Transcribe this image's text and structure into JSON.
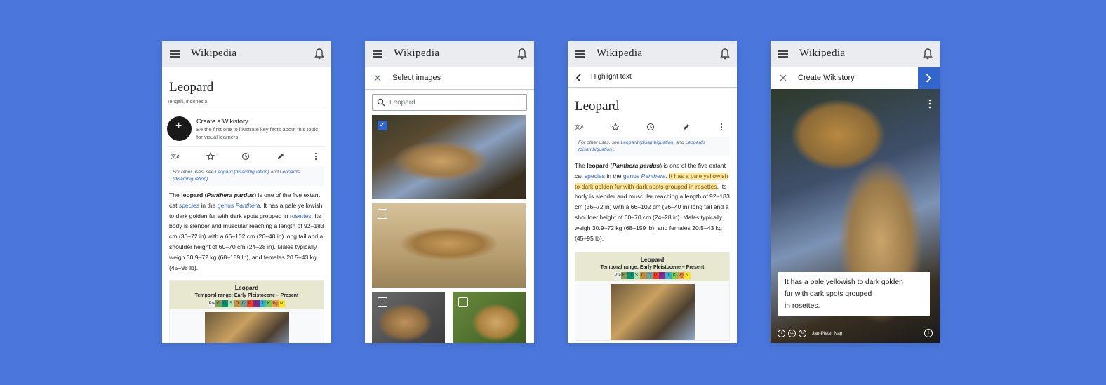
{
  "brand": {
    "wordmark": "Wikipedia",
    "background": "#4b77dc",
    "link_color": "#3366cc",
    "highlight_color": "#fce8a4"
  },
  "article": {
    "title": "Leopard",
    "subtitle": "Tengah, Indonesia",
    "hatnote_pre": "For other uses, see ",
    "hatnote_link1": "Leopard (disambiguation)",
    "hatnote_mid": " and ",
    "hatnote_link2": "Leopards (disambiguation)",
    "hatnote_post": ".",
    "p_the": "The ",
    "p_leopard": "leopard",
    "p_open": " (",
    "p_sci": "Panthera pardus",
    "p_close": ") is one of the five extant cat ",
    "p_species": "species",
    "p_in": " in the ",
    "p_genus": "genus",
    "p_space": " ",
    "p_panthera": "Panthera",
    "p_dot": ". ",
    "p_fur": "It has a pale yellowish to dark golden fur with dark spots grouped in ",
    "p_rosettes": "rosettes",
    "p_rest": ". Its body is slender and muscular reaching a length of 92–183 cm (36–72 in) with a 66–102 cm (26–40 in) long tail and a shoulder height of 60–70 cm (24–28 in). Males typically weigh 30.9–72 kg (68–159 lb), and females 20.5–43 kg (45–95 lb).",
    "infobox_title": "Leopard",
    "infobox_subtitle": "Temporal range: Early Pleistocene – Present",
    "timeline": [
      "Pre",
      "Є",
      "O",
      "S",
      "D",
      "C",
      "P",
      "T",
      "J",
      "K",
      "Pg",
      "N"
    ],
    "timeline_colors": [
      "#f0f0f0",
      "#7fa056",
      "#009270",
      "#b3e1b6",
      "#cb8c37",
      "#67a599",
      "#f04028",
      "#812b92",
      "#34b2c9",
      "#7fc64e",
      "#fd9a52",
      "#ffe619"
    ]
  },
  "wikistory": {
    "title": "Create a Wikistory",
    "desc": "Be the first one to illustrate key facts about this topic for visual learners."
  },
  "icons": [
    "menu-icon",
    "bell-icon",
    "translate-icon",
    "star-icon",
    "history-icon",
    "edit-icon",
    "more-icon",
    "close-icon",
    "search-icon",
    "back-icon",
    "next-icon",
    "check-icon",
    "info-icon",
    "cc-by-icon",
    "cc-icon",
    "cc-sa-icon"
  ],
  "select_images": {
    "title": "Select images",
    "search_value": "Leopard",
    "selected": [
      true,
      false,
      false,
      false
    ]
  },
  "highlight": {
    "title": "Highlight text"
  },
  "story": {
    "title": "Create Wikistory",
    "caption_line1": "It has a pale yellowish to dark golden",
    "caption_line2": "fur with dark spots grouped",
    "caption_line3": "in rosettes.",
    "credit": "Jan-Pieter Nap"
  }
}
